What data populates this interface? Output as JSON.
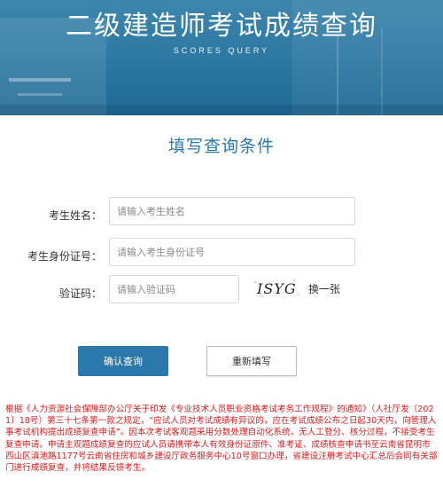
{
  "banner": {
    "title": "二级建造师考试成绩查询",
    "subtitle": "SCORES QUERY",
    "color": "#2f7aa4"
  },
  "form": {
    "heading": "填写查询条件",
    "name": {
      "label": "考生姓名：",
      "placeholder": "请输入考生姓名",
      "value": ""
    },
    "id_number": {
      "label": "考生身份证号：",
      "placeholder": "请输入考生身份证号",
      "value": ""
    },
    "captcha": {
      "label": "验证码：",
      "placeholder": "请输入验证码",
      "value": "",
      "image_text": "ISYG",
      "refresh_label": "换一张"
    },
    "submit_label": "确认查询",
    "reset_label": "重新填写"
  },
  "notice": {
    "text": "根据《人力资源社会保障部办公厅关于印发《专业技术人员职业资格考试考务工作规程》的通知》（人社厅发〔2021〕18号）第三十七条第一款之规定，“应试人员对考试成绩有异议的，应在考试成绩公布之日起30天内，向管理人事考试机构提出成绩复查申请”。因本次考试客观题采用分数处理自动化系统，无人工登分、核分过程，不接受考生复查申请。申请主观题成绩复查的应试人员请携带本人有效身份证原件、准考证、成绩核查申请书至云南省昆明市西山区滇池路1177号云南省住房和城乡建设厅政务服务中心10号窗口办理，省建设注册考试中心汇总后会同有关部门进行成绩复查，并将结果反馈考生。",
    "color": "#d42020"
  },
  "colors": {
    "accent": "#2b78ab",
    "heading": "#2a78a8"
  }
}
